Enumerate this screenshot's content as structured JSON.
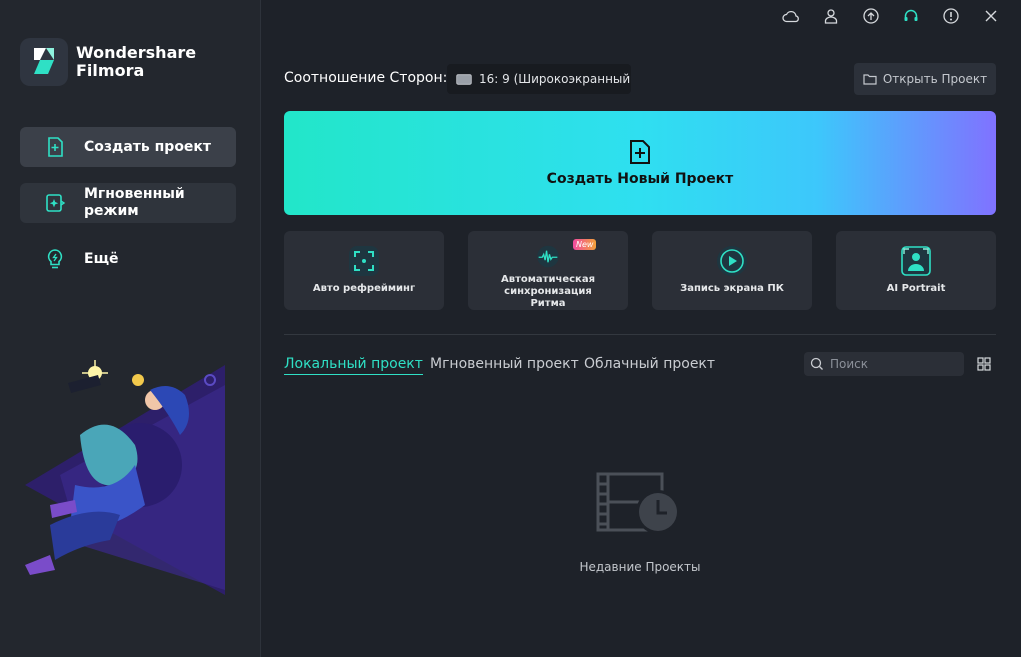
{
  "app": {
    "logo_line1": "Wondershare",
    "logo_line2": "Filmora"
  },
  "sidebar": {
    "items": [
      {
        "label": "Создать проект",
        "icon": "add-file-icon"
      },
      {
        "label": "Мгновенный режим",
        "icon": "instant-mode-icon"
      },
      {
        "label": "Ещё",
        "icon": "lightbulb-icon"
      }
    ]
  },
  "titlebar": {
    "icons": [
      "cloud-icon",
      "account-icon",
      "upload-icon",
      "headset-icon",
      "info-icon",
      "close-icon"
    ]
  },
  "aspect": {
    "label": "Соотношение Сторон:",
    "value": "16: 9 (Широкоэкранный"
  },
  "open_project": {
    "label": "Открыть Проект"
  },
  "create_new": {
    "label": "Создать Новый Проект"
  },
  "tools": [
    {
      "label": "Авто рефрейминг",
      "icon": "auto-reframe-icon"
    },
    {
      "label": "Автоматическая синхронизация Ритма",
      "icon": "beat-sync-icon",
      "badge": "New"
    },
    {
      "label": "Запись экрана ПК",
      "icon": "screen-record-icon"
    },
    {
      "label": "AI Portrait",
      "icon": "ai-portrait-icon"
    }
  ],
  "tabs": [
    {
      "label": "Локальный проект",
      "active": true
    },
    {
      "label": "Мгновенный проект",
      "active": false
    },
    {
      "label": "Облачный проект",
      "active": false
    }
  ],
  "search": {
    "placeholder": "Поиск"
  },
  "empty_state": {
    "label": "Недавние Проекты"
  },
  "colors": {
    "accent": "#2fe0c5",
    "background": "#1e2229",
    "sidebar": "#23272e",
    "card": "#2b2f37"
  }
}
